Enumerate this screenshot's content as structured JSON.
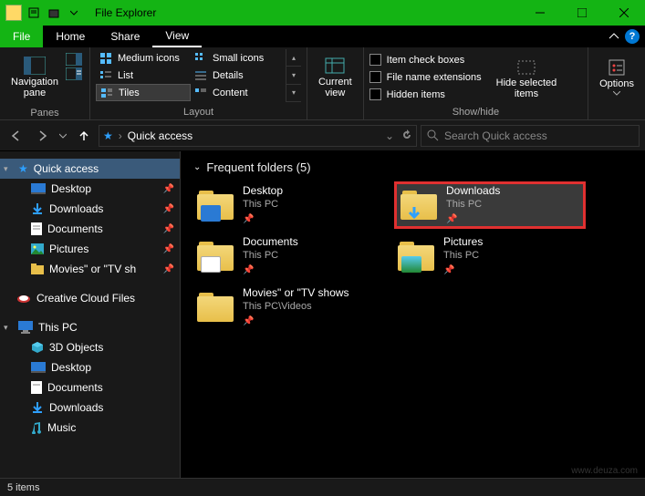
{
  "window": {
    "title": "File Explorer"
  },
  "ribbon_tabs": {
    "file": "File",
    "home": "Home",
    "share": "Share",
    "view": "View"
  },
  "ribbon": {
    "panes": {
      "nav": "Navigation\npane",
      "group": "Panes"
    },
    "layout": {
      "group": "Layout",
      "items": [
        "Medium icons",
        "Small icons",
        "List",
        "Details",
        "Tiles",
        "Content"
      ]
    },
    "current_view": {
      "label": "Current\nview"
    },
    "showhide": {
      "group": "Show/hide",
      "checks": [
        "Item check boxes",
        "File name extensions",
        "Hidden items"
      ],
      "hide": "Hide selected\nitems"
    },
    "options": "Options"
  },
  "nav": {
    "location": "Quick access",
    "search_placeholder": "Search Quick access"
  },
  "sidebar": {
    "quick": "Quick access",
    "quick_items": [
      {
        "label": "Desktop"
      },
      {
        "label": "Downloads"
      },
      {
        "label": "Documents"
      },
      {
        "label": "Pictures"
      },
      {
        "label": "Movies\" or \"TV sh"
      }
    ],
    "creative": "Creative Cloud Files",
    "thispc": "This PC",
    "thispc_items": [
      {
        "label": "3D Objects"
      },
      {
        "label": "Desktop"
      },
      {
        "label": "Documents"
      },
      {
        "label": "Downloads"
      },
      {
        "label": "Music"
      }
    ]
  },
  "main": {
    "group_title": "Frequent folders (5)",
    "folders": [
      {
        "name": "Desktop",
        "loc": "This PC"
      },
      {
        "name": "Downloads",
        "loc": "This PC",
        "highlight": true
      },
      {
        "name": "Documents",
        "loc": "This PC"
      },
      {
        "name": "Pictures",
        "loc": "This PC"
      },
      {
        "name": "Movies\" or \"TV shows",
        "loc": "This PC\\Videos"
      }
    ]
  },
  "status": "5 items",
  "watermark": "www.deuza.com"
}
